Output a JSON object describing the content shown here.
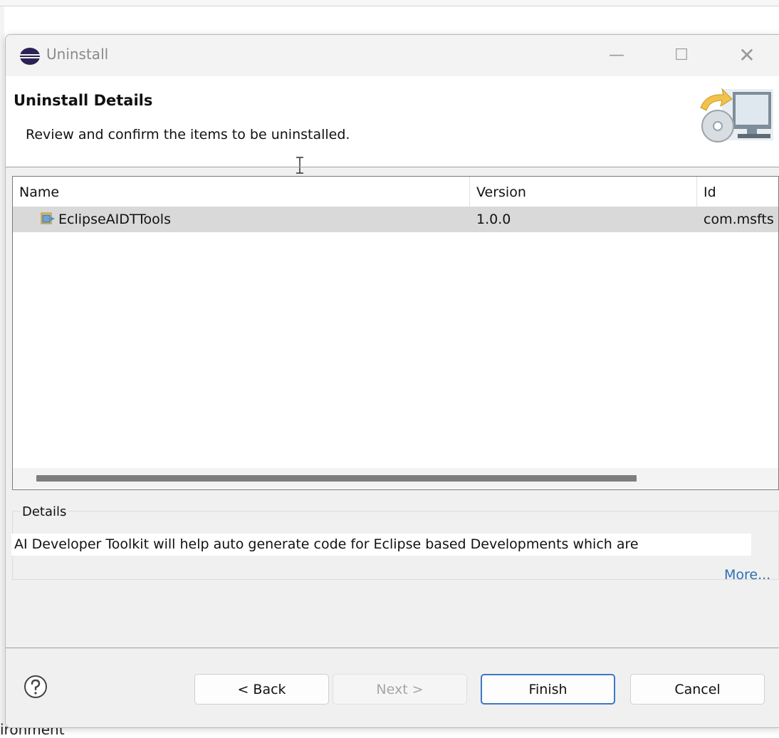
{
  "window": {
    "title": "Uninstall",
    "minimize_glyph": "—",
    "maximize_glyph": "☐",
    "close_glyph": "✕"
  },
  "header": {
    "title": "Uninstall Details",
    "description": "Review and confirm the items to be uninstalled."
  },
  "table": {
    "columns": [
      "Name",
      "Version",
      "Id"
    ],
    "rows": [
      {
        "name": "EclipseAIDTTools",
        "version": "1.0.0",
        "id": "com.msfts"
      }
    ]
  },
  "details": {
    "label": "Details",
    "text": "AI Developer Toolkit will help auto generate code for Eclipse based Developments which are",
    "more_link": "More..."
  },
  "buttons": {
    "back": "< Back",
    "next": "Next >",
    "finish": "Finish",
    "cancel": "Cancel"
  },
  "background": {
    "status_text": "ironment"
  },
  "colors": {
    "accent": "#3c78c4",
    "link": "#2b6fb5",
    "selected_row": "#d9d9d9"
  },
  "icons": {
    "app": "eclipse-logo-icon",
    "banner": "uninstall-banner-icon",
    "row": "feature-icon",
    "help": "help-icon"
  }
}
